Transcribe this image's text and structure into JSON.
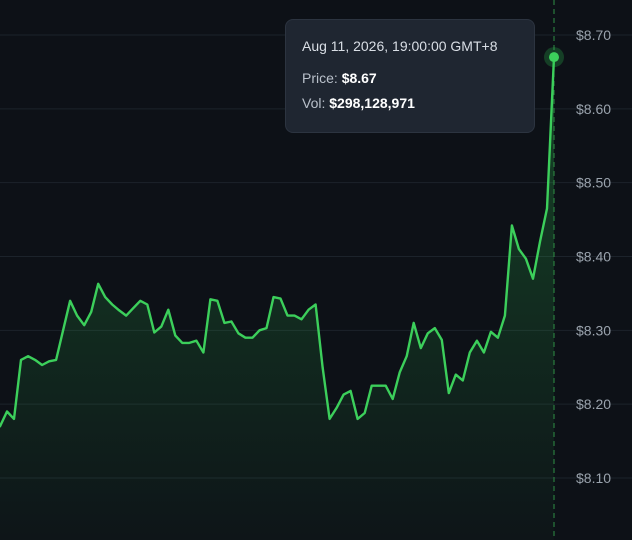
{
  "chart_data": {
    "type": "line",
    "x": [
      1,
      2,
      3,
      4,
      5,
      6,
      7,
      8,
      9,
      10,
      11,
      12,
      13,
      14,
      15,
      16,
      17,
      18,
      19,
      20,
      21,
      22,
      23,
      24,
      25,
      26,
      27,
      28,
      29,
      30,
      31,
      32,
      33,
      34,
      35,
      36,
      37,
      38,
      39,
      40,
      41,
      42,
      43,
      44,
      45,
      46,
      47,
      48,
      49,
      50,
      51,
      52,
      53,
      54,
      55,
      56,
      57,
      58,
      59,
      60,
      61,
      62,
      63,
      64,
      65,
      66,
      67,
      68,
      69,
      70,
      71,
      72,
      73,
      74,
      75,
      76,
      77,
      78,
      79,
      80
    ],
    "values": [
      8.17,
      8.19,
      8.18,
      8.26,
      8.265,
      8.26,
      8.253,
      8.258,
      8.26,
      8.3,
      8.34,
      8.32,
      8.307,
      8.325,
      8.363,
      8.345,
      8.335,
      8.327,
      8.32,
      8.33,
      8.34,
      8.335,
      8.297,
      8.305,
      8.328,
      8.293,
      8.283,
      8.283,
      8.286,
      8.27,
      8.342,
      8.34,
      8.31,
      8.312,
      8.296,
      8.29,
      8.29,
      8.3,
      8.303,
      8.345,
      8.343,
      8.32,
      8.32,
      8.315,
      8.328,
      8.335,
      8.25,
      8.18,
      8.195,
      8.213,
      8.218,
      8.18,
      8.188,
      8.225,
      8.225,
      8.225,
      8.207,
      8.243,
      8.265,
      8.31,
      8.276,
      8.296,
      8.303,
      8.287,
      8.215,
      8.24,
      8.232,
      8.27,
      8.286,
      8.27,
      8.298,
      8.29,
      8.32,
      8.442,
      8.41,
      8.397,
      8.37,
      8.42,
      8.465,
      8.67
    ],
    "ylim": [
      8.05,
      8.72
    ],
    "yticks": [
      "$8.10",
      "$8.20",
      "$8.30",
      "$8.40",
      "$8.50",
      "$8.60",
      "$8.70"
    ],
    "ytick_values": [
      8.1,
      8.2,
      8.3,
      8.4,
      8.5,
      8.6,
      8.7
    ],
    "grid": true,
    "line_color": "#3ccf5b",
    "highlight_index": 79
  },
  "tooltip": {
    "date": "Aug 11, 2026, 19:00:00 GMT+8",
    "price_label": "Price:",
    "price_value": "$8.67",
    "vol_label": "Vol:",
    "vol_value": "$298,128,971"
  },
  "colors": {
    "background": "#0d1117",
    "grid": "#1c232b",
    "axis_text": "#9aa3ad",
    "crosshair": "#2f8f45"
  }
}
